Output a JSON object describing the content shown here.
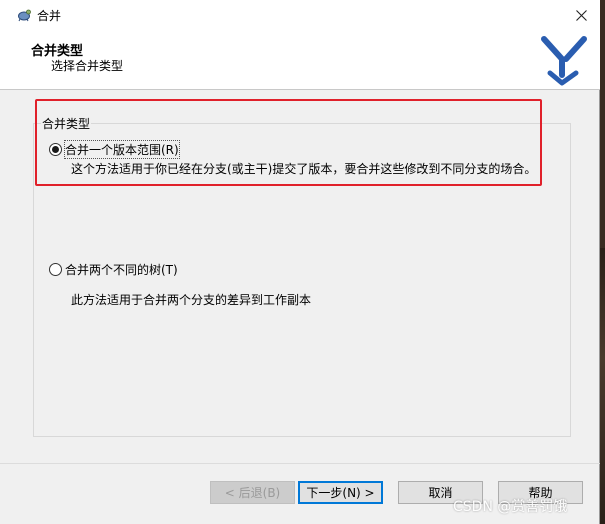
{
  "window": {
    "title": "合并"
  },
  "header": {
    "title": "合并类型",
    "subtitle": "选择合并类型"
  },
  "group": {
    "label": "合并类型"
  },
  "options": [
    {
      "label": "合并一个版本范围(R)",
      "selected": true,
      "description": "这个方法适用于你已经在分支(或主干)提交了版本，要合并这些修改到不同分支的场合。"
    },
    {
      "label": "合并两个不同的树(T)",
      "selected": false,
      "description": "此方法适用于合并两个分支的差异到工作副本"
    }
  ],
  "buttons": {
    "back": "< 后退(B)",
    "next": "下一步(N) >",
    "cancel": "取消",
    "help": "帮助"
  },
  "watermark": "CSDN @赏善罚饿",
  "colors": {
    "highlight": "#e0202a",
    "accent": "#0078d7",
    "logo": "#2a5db0"
  }
}
